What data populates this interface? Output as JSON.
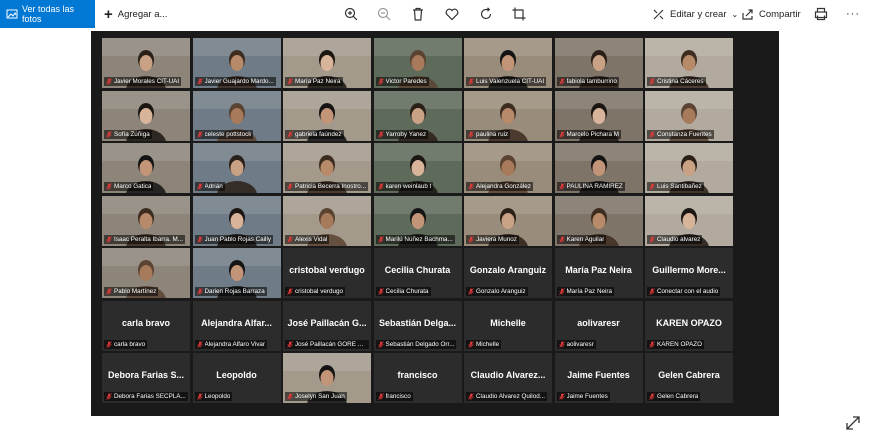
{
  "toolbar": {
    "view_all_label": "Ver todas las fotos",
    "add_label": "Agregar a...",
    "edit_create_label": "Editar y crear",
    "share_label": "Compartir",
    "more_label": "···"
  },
  "colors": {
    "accent": "#0078d4",
    "stage": "#1a1a1a",
    "tile": "#2c2c2c",
    "active_border": "#d6d35a",
    "mic_muted": "#e03a3a"
  },
  "participants": [
    {
      "name": "Javier Morales CIT-UAI",
      "video": true
    },
    {
      "name": "Javier Guajardo Mardo...",
      "video": true
    },
    {
      "name": "María Paz Neira",
      "video": true
    },
    {
      "name": "Victor Paredes",
      "video": true
    },
    {
      "name": "Luis Valenzuela CIT-UAI",
      "video": true
    },
    {
      "name": "fabiola tamburrino",
      "video": true
    },
    {
      "name": "Cristina Cáceres",
      "video": true
    },
    {
      "name": "Sofía Zúñiga",
      "video": true
    },
    {
      "name": "celeste pottstock",
      "video": true
    },
    {
      "name": "gabriela faúndez",
      "video": true
    },
    {
      "name": "Yarroby Yanez",
      "video": true,
      "active": true
    },
    {
      "name": "paulina ruiz",
      "video": true
    },
    {
      "name": "Marcelo Pichara M",
      "video": true
    },
    {
      "name": "Constanza Fuentes",
      "video": true
    },
    {
      "name": "Marco Gatica",
      "video": true
    },
    {
      "name": "Adrián",
      "video": true
    },
    {
      "name": "Patricia Becerra Inostro...",
      "video": true
    },
    {
      "name": "karen weinlaub t",
      "video": true
    },
    {
      "name": "Alejandra González",
      "video": true
    },
    {
      "name": "PAULINA RAMIREZ",
      "video": true
    },
    {
      "name": "Luis Santibañez",
      "video": true
    },
    {
      "name": "Isaac Peralta Ibarra. M...",
      "video": true
    },
    {
      "name": "Juan Pablo Rojas Cailly",
      "video": true
    },
    {
      "name": "Alexis Vidal",
      "video": true
    },
    {
      "name": "Marilú Núñez Bachma...",
      "video": true
    },
    {
      "name": "Javiera Munoz",
      "video": true
    },
    {
      "name": "Karen Aguilar",
      "video": true
    },
    {
      "name": "Claudio alvarez",
      "video": true
    },
    {
      "name": "Pablo Martínez",
      "video": true
    },
    {
      "name": "Darien Rojas Barraza",
      "video": true
    },
    {
      "name": "cristobal verdugo",
      "big": "cristobal verdugo",
      "video": false
    },
    {
      "name": "Cecilia Churata",
      "big": "Cecilia Churata",
      "video": false
    },
    {
      "name": "Gonzalo Aranguiz",
      "big": "Gonzalo Aranguiz",
      "video": false
    },
    {
      "name": "María Paz Neira",
      "big": "María Paz Neira",
      "video": false
    },
    {
      "name": "Conectar con el audio",
      "big": "Guillermo More...",
      "video": false
    },
    {
      "name": "carla bravo",
      "big": "carla bravo",
      "video": false
    },
    {
      "name": "Alejandra Alfaro Vivar",
      "big": "Alejandra Alfar...",
      "video": false
    },
    {
      "name": "José Paillacán GORE Ar...",
      "big": "José Paillacán G...",
      "video": false
    },
    {
      "name": "Sebastián Delgado Orr...",
      "big": "Sebastián Delga...",
      "video": false
    },
    {
      "name": "Michelle",
      "big": "Michelle",
      "video": false
    },
    {
      "name": "aolivaresr",
      "big": "aolivaresr",
      "video": false
    },
    {
      "name": "KAREN OPAZO",
      "big": "KAREN OPAZO",
      "video": false
    },
    {
      "name": "Debora Farias SECPLA...",
      "big": "Debora Farias S...",
      "video": false
    },
    {
      "name": "Leopoldo",
      "big": "Leopoldo",
      "video": false
    },
    {
      "name": "Joselyn San Juan",
      "video": true
    },
    {
      "name": "francisco",
      "big": "francisco",
      "video": false
    },
    {
      "name": "Claudio Alvarez Quilod...",
      "big": "Claudio Alvarez...",
      "video": false
    },
    {
      "name": "Jaime Fuentes",
      "big": "Jaime Fuentes",
      "video": false
    },
    {
      "name": "Gelen Cabrera",
      "big": "Gelen Cabrera",
      "video": false
    }
  ]
}
